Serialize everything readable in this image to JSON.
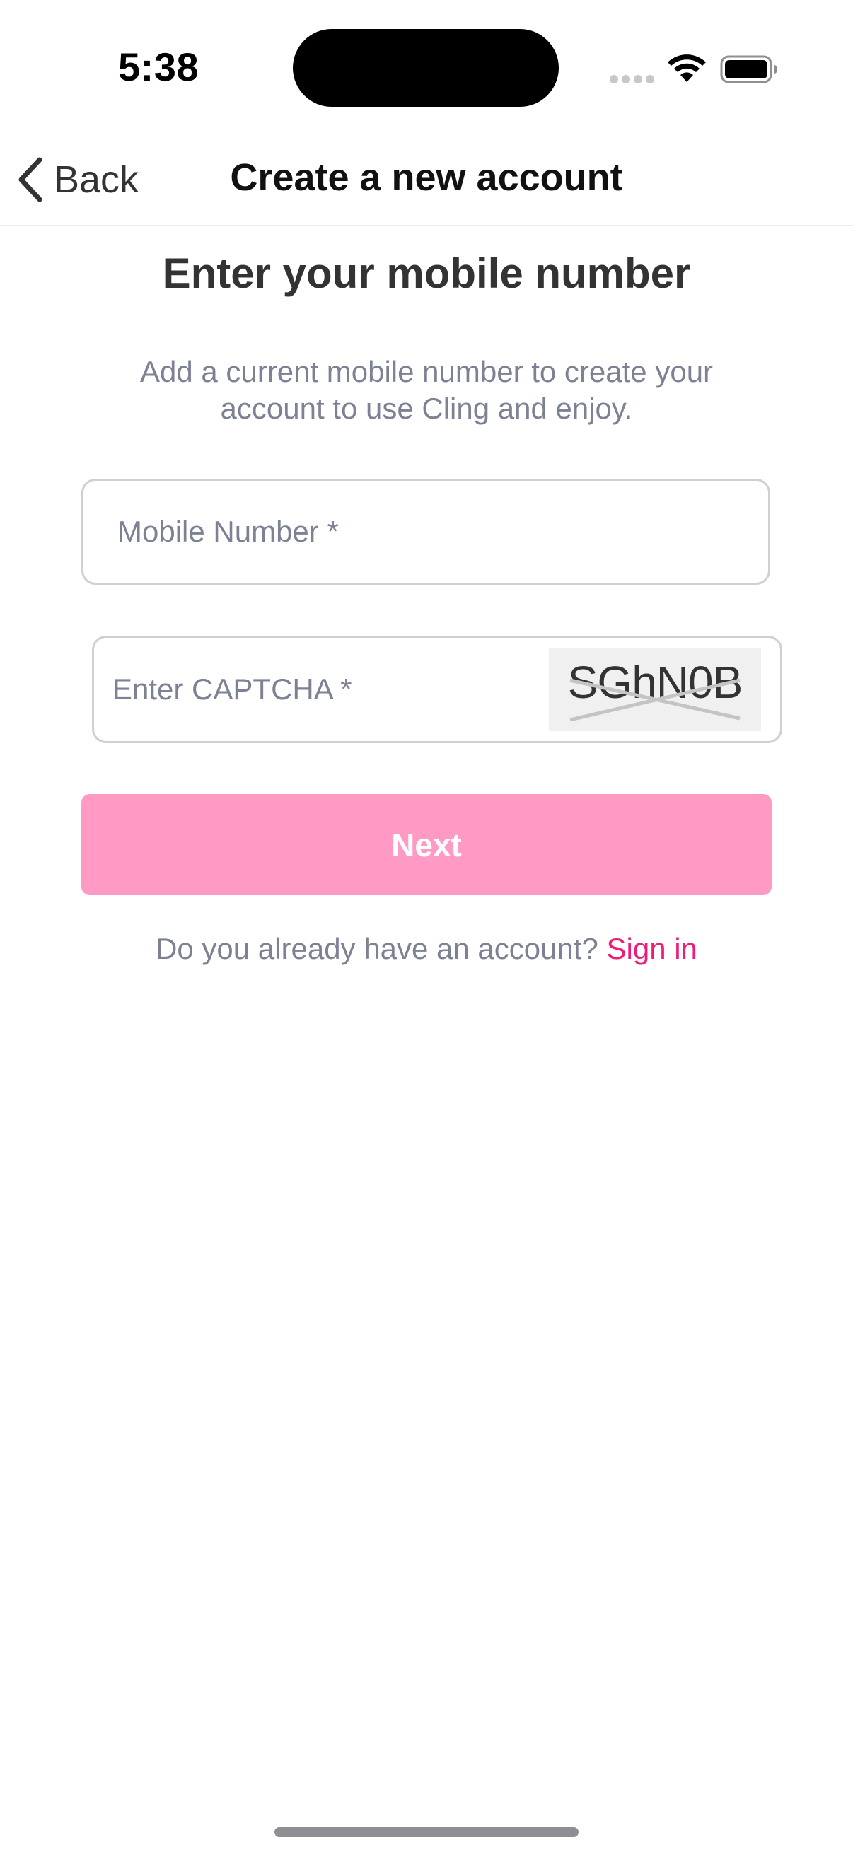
{
  "status_bar": {
    "time": "5:38"
  },
  "nav": {
    "back_label": "Back",
    "title": "Create a new account"
  },
  "content": {
    "heading": "Enter your mobile number",
    "description": "Add a current mobile number to create your account to use Cling and enjoy.",
    "mobile_input": {
      "placeholder": "Mobile Number *",
      "value": ""
    },
    "captcha_input": {
      "placeholder": "Enter CAPTCHA *",
      "value": ""
    },
    "captcha_code": "SGhN0B",
    "next_label": "Next",
    "signin_prompt": "Do you already have an account?",
    "signin_link": "Sign in"
  },
  "colors": {
    "accent": "#ee1c78",
    "button_disabled": "#ff9ac4",
    "muted_text": "#7c8294",
    "heading_text": "#333333"
  },
  "icons": {
    "back": "chevron-left-icon",
    "wifi": "wifi-icon",
    "battery": "battery-icon",
    "signal": "signal-dots-icon"
  }
}
